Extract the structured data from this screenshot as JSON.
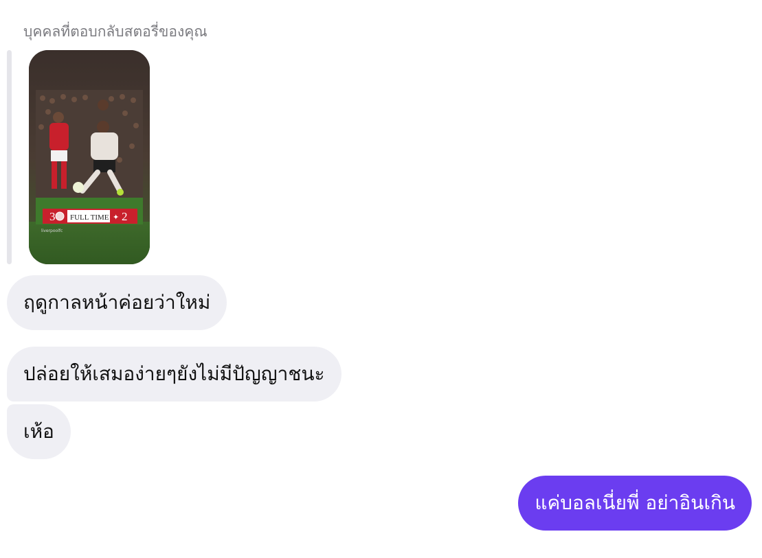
{
  "story_reply": {
    "caption": "บุคคลที่ตอบกลับสตอรี่ของคุณ",
    "thumbnail": {
      "scoreboard": {
        "home_score": "3",
        "label": "FULL TIME",
        "away_score": "2"
      },
      "watermark": "liverpoolfc"
    }
  },
  "messages": [
    {
      "direction": "incoming",
      "text": "ฤดูกาลหน้าค่อยว่าใหม่"
    },
    {
      "direction": "incoming",
      "text": "ปล่อยให้เสมอง่ายๆยังไม่มีปัญญาชนะ"
    },
    {
      "direction": "incoming",
      "text": "เห้อ"
    },
    {
      "direction": "outgoing",
      "text": "แค่บอลเนี่ยพี่ อย่าอินเกิน"
    }
  ],
  "colors": {
    "incoming_bubble": "#efeff4",
    "outgoing_bubble": "#6b3df0",
    "caption_text": "#7a7a7f"
  }
}
